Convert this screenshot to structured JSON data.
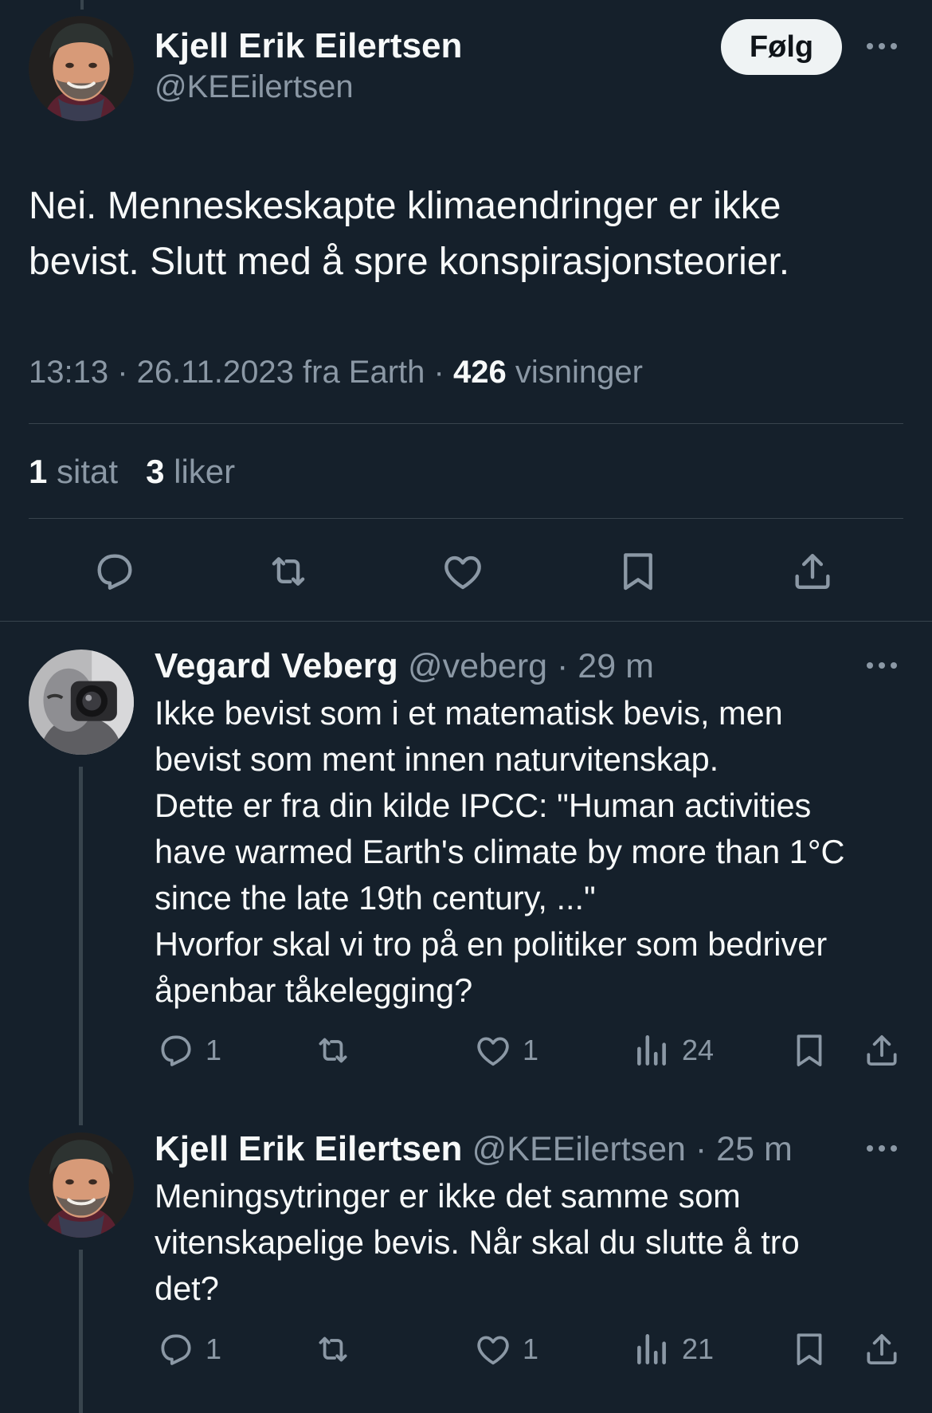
{
  "main_tweet": {
    "author_name": "Kjell Erik Eilertsen",
    "handle": "@KEEilertsen",
    "follow_label": "Følg",
    "text": "Nei. Menneskeskapte klimaendringer er ikke bevist. Slutt med å spre konspirasjonsteorier.",
    "time": "13:13",
    "date": "26.11.2023",
    "source": "fra Earth",
    "views_count": "426",
    "views_label": "visninger",
    "quotes_count": "1",
    "quotes_label": "sitat",
    "likes_count": "3",
    "likes_label": "liker"
  },
  "replies": [
    {
      "author_name": "Vegard Veberg",
      "handle": "@veberg",
      "age": "29 m",
      "text": "Ikke bevist som i et matematisk bevis, men\nbevist som ment innen naturvitenskap.\nDette er fra din kilde IPCC: \"Human activities\nhave warmed Earth's climate by more than 1°C\nsince the late 19th century, ...\"\nHvorfor skal vi tro på en politiker som bedriver\nåpenbar tåkelegging?",
      "reply_count": "1",
      "like_count": "1",
      "view_count": "24"
    },
    {
      "author_name": "Kjell Erik Eilertsen",
      "handle": "@KEEilertsen",
      "age": "25 m",
      "text": "Meningsytringer er ikke det samme som\nvitenskapelige bevis. Når skal du slutte å tro\ndet?",
      "reply_count": "1",
      "like_count": "1",
      "view_count": "21"
    }
  ],
  "colors": {
    "background": "#15202b",
    "text": "#f7f9f9",
    "muted": "#8b98a5",
    "divider": "#38444d",
    "button_bg": "#eff3f4"
  },
  "icons": [
    "reply-icon",
    "retweet-icon",
    "like-icon",
    "bookmark-icon",
    "share-icon",
    "views-icon",
    "more-icon"
  ]
}
